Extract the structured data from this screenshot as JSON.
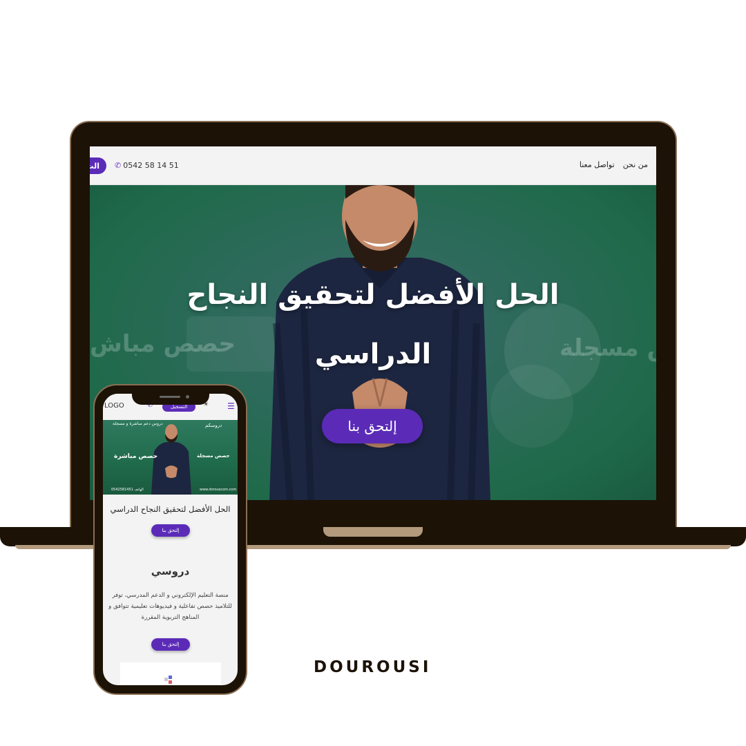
{
  "brand": "DOUROUSI",
  "colors": {
    "accent": "#5b2bb8",
    "frame": "#1c1206",
    "frame_trim": "#b39a7d",
    "hero_green": "#1f6a4a"
  },
  "desktop": {
    "nav": {
      "about": "من نحن",
      "contact": "تواصل معنا"
    },
    "phone_number": "0542 58 14 51",
    "signup_partial": "الت",
    "hero": {
      "title_line1": "الحل الأفضل لتحقيق النجاح",
      "title_line2": "الدراسي",
      "cta": "إلتحق بنا",
      "bg_left": "حصص مباش",
      "bg_right": "ص مسجلة"
    }
  },
  "mobile": {
    "logo": "LOGO",
    "signup": "التسجيل",
    "hero": {
      "top_caption": "دروس دعم مباشرة و مسجلة",
      "brand_small": "دروسكم",
      "word_left": "حصص مباشرة",
      "word_right": "حصص مسجلة",
      "footer_left": "الهاتف 0542581451",
      "footer_right": "www.dorouscom.com"
    },
    "title": "الحل الأفضل لتحقيق النجاح الدراسي",
    "cta": "إلتحق بنا",
    "section_title": "دروسي",
    "description": "منصة التعليم الإلكتروني و الدعم المدرسي، توفر للتلاميذ حصص تفاعلية و فيديوهات تعليمية تتوافق و المناهج التربوية المقررة",
    "cta2": "إلتحق بنا"
  }
}
